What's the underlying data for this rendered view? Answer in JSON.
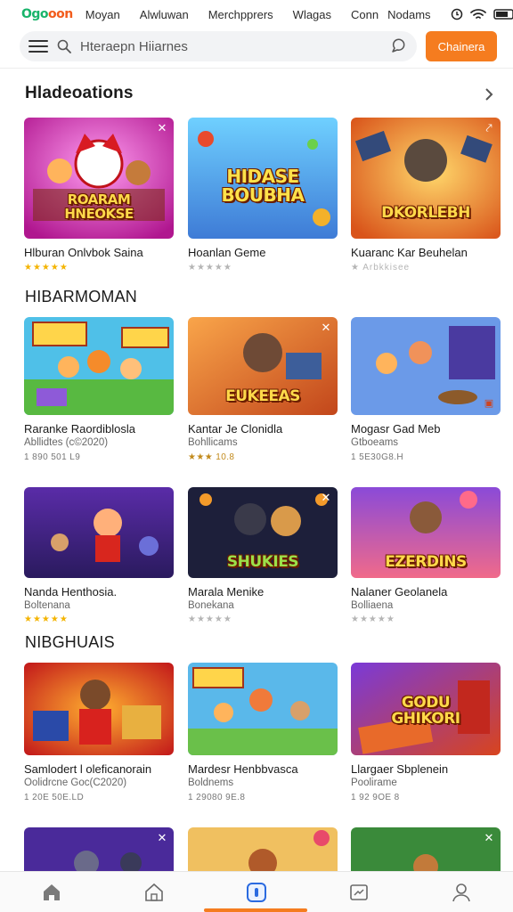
{
  "brand": {
    "logo_a": "Ogo",
    "logo_b": "oon",
    "accent": "#f57c1f"
  },
  "nav": {
    "links": [
      "Moyan",
      "Alwluwan",
      "Merchpprers",
      "Wlagas",
      "Conn",
      "Nodams"
    ]
  },
  "search": {
    "placeholder": "Hteraepn Hiiarnes"
  },
  "cta": {
    "label": "Chainera"
  },
  "sections": [
    {
      "title": "Hladeoations",
      "cards": [
        {
          "name": "Hlburan Onlvbok Saina",
          "banner": "ROARAM\nHNEOKSE",
          "stars": "★★★★★",
          "star_style": "gold"
        },
        {
          "name": "Hoanlan Geme",
          "banner": "HIDASE\nBOUBHA",
          "stars": "★★★★★",
          "star_style": "grey"
        },
        {
          "name": "Kuaranc Kar Beuhelan",
          "banner": "DKORLEBH",
          "stars": "★ Arbkkisee",
          "star_style": "grey"
        }
      ]
    },
    {
      "title": "HIBARMOMAN",
      "cards": [
        {
          "name": "Raranke Raordiblosla",
          "sub": "Abllidtes (c©2020)",
          "meta": "1 890 501 L9"
        },
        {
          "name": "Kantar Je Clonidla",
          "sub": "Bohllicams",
          "meta": "★★★ 10.8",
          "banner": "EUKEEAS"
        },
        {
          "name": "Mogasr Gad Meb",
          "sub": "Gtboeams",
          "meta": "1 5E30G8.H"
        }
      ]
    },
    {
      "title": "",
      "cards": [
        {
          "name": "Nanda Henthosia.",
          "sub": "Boltenana",
          "stars": "★★★★★",
          "star_style": "gold"
        },
        {
          "name": "Marala Menike",
          "sub": "Bonekana",
          "stars": "★★★★★",
          "star_style": "grey",
          "banner": "SHUKIES"
        },
        {
          "name": "Nalaner Geolanela",
          "sub": "Bolliaena",
          "stars": "★★★★★",
          "star_style": "grey",
          "banner": "EZERDINS"
        }
      ]
    },
    {
      "title": "NIBGHUAIS",
      "cards": [
        {
          "name": "Samlodert l oleficanorain",
          "sub": "Oolidrcne Goc(C2020)",
          "meta": "1 20E 50E.LD"
        },
        {
          "name": "Mardesr Henbbvasca",
          "sub": "Boldnems",
          "meta": "1 29080 9E.8"
        },
        {
          "name": "Llargaer Sbplenein",
          "sub": "Poolirame",
          "meta": "1 92 9OE 8",
          "banner": "GODU\nGHIKORI"
        }
      ]
    }
  ],
  "bottom_nav": [
    "home-icon",
    "store-icon",
    "play-icon",
    "news-icon",
    "profile-icon"
  ]
}
